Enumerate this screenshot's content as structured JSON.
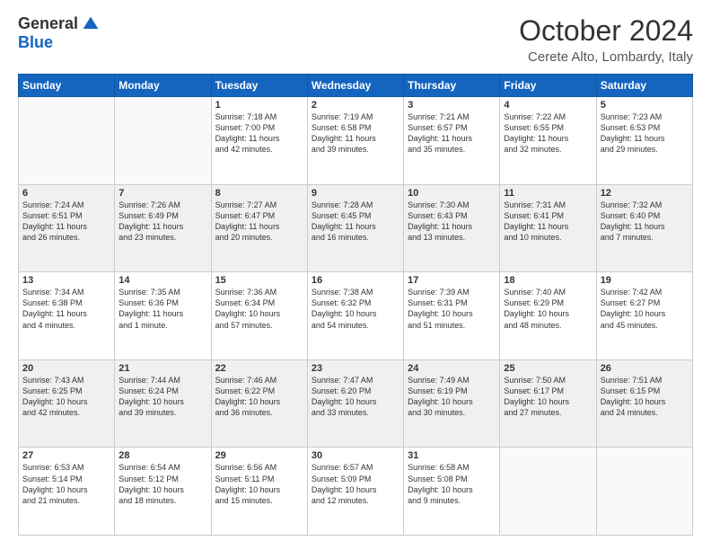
{
  "logo": {
    "general": "General",
    "blue": "Blue"
  },
  "title": "October 2024",
  "location": "Cerete Alto, Lombardy, Italy",
  "days_header": [
    "Sunday",
    "Monday",
    "Tuesday",
    "Wednesday",
    "Thursday",
    "Friday",
    "Saturday"
  ],
  "weeks": [
    [
      {
        "day": "",
        "info": "",
        "empty": true
      },
      {
        "day": "",
        "info": "",
        "empty": true
      },
      {
        "day": "1",
        "info": "Sunrise: 7:18 AM\nSunset: 7:00 PM\nDaylight: 11 hours\nand 42 minutes."
      },
      {
        "day": "2",
        "info": "Sunrise: 7:19 AM\nSunset: 6:58 PM\nDaylight: 11 hours\nand 39 minutes."
      },
      {
        "day": "3",
        "info": "Sunrise: 7:21 AM\nSunset: 6:57 PM\nDaylight: 11 hours\nand 35 minutes."
      },
      {
        "day": "4",
        "info": "Sunrise: 7:22 AM\nSunset: 6:55 PM\nDaylight: 11 hours\nand 32 minutes."
      },
      {
        "day": "5",
        "info": "Sunrise: 7:23 AM\nSunset: 6:53 PM\nDaylight: 11 hours\nand 29 minutes."
      }
    ],
    [
      {
        "day": "6",
        "info": "Sunrise: 7:24 AM\nSunset: 6:51 PM\nDaylight: 11 hours\nand 26 minutes.",
        "shaded": true
      },
      {
        "day": "7",
        "info": "Sunrise: 7:26 AM\nSunset: 6:49 PM\nDaylight: 11 hours\nand 23 minutes.",
        "shaded": true
      },
      {
        "day": "8",
        "info": "Sunrise: 7:27 AM\nSunset: 6:47 PM\nDaylight: 11 hours\nand 20 minutes.",
        "shaded": true
      },
      {
        "day": "9",
        "info": "Sunrise: 7:28 AM\nSunset: 6:45 PM\nDaylight: 11 hours\nand 16 minutes.",
        "shaded": true
      },
      {
        "day": "10",
        "info": "Sunrise: 7:30 AM\nSunset: 6:43 PM\nDaylight: 11 hours\nand 13 minutes.",
        "shaded": true
      },
      {
        "day": "11",
        "info": "Sunrise: 7:31 AM\nSunset: 6:41 PM\nDaylight: 11 hours\nand 10 minutes.",
        "shaded": true
      },
      {
        "day": "12",
        "info": "Sunrise: 7:32 AM\nSunset: 6:40 PM\nDaylight: 11 hours\nand 7 minutes.",
        "shaded": true
      }
    ],
    [
      {
        "day": "13",
        "info": "Sunrise: 7:34 AM\nSunset: 6:38 PM\nDaylight: 11 hours\nand 4 minutes."
      },
      {
        "day": "14",
        "info": "Sunrise: 7:35 AM\nSunset: 6:36 PM\nDaylight: 11 hours\nand 1 minute."
      },
      {
        "day": "15",
        "info": "Sunrise: 7:36 AM\nSunset: 6:34 PM\nDaylight: 10 hours\nand 57 minutes."
      },
      {
        "day": "16",
        "info": "Sunrise: 7:38 AM\nSunset: 6:32 PM\nDaylight: 10 hours\nand 54 minutes."
      },
      {
        "day": "17",
        "info": "Sunrise: 7:39 AM\nSunset: 6:31 PM\nDaylight: 10 hours\nand 51 minutes."
      },
      {
        "day": "18",
        "info": "Sunrise: 7:40 AM\nSunset: 6:29 PM\nDaylight: 10 hours\nand 48 minutes."
      },
      {
        "day": "19",
        "info": "Sunrise: 7:42 AM\nSunset: 6:27 PM\nDaylight: 10 hours\nand 45 minutes."
      }
    ],
    [
      {
        "day": "20",
        "info": "Sunrise: 7:43 AM\nSunset: 6:25 PM\nDaylight: 10 hours\nand 42 minutes.",
        "shaded": true
      },
      {
        "day": "21",
        "info": "Sunrise: 7:44 AM\nSunset: 6:24 PM\nDaylight: 10 hours\nand 39 minutes.",
        "shaded": true
      },
      {
        "day": "22",
        "info": "Sunrise: 7:46 AM\nSunset: 6:22 PM\nDaylight: 10 hours\nand 36 minutes.",
        "shaded": true
      },
      {
        "day": "23",
        "info": "Sunrise: 7:47 AM\nSunset: 6:20 PM\nDaylight: 10 hours\nand 33 minutes.",
        "shaded": true
      },
      {
        "day": "24",
        "info": "Sunrise: 7:49 AM\nSunset: 6:19 PM\nDaylight: 10 hours\nand 30 minutes.",
        "shaded": true
      },
      {
        "day": "25",
        "info": "Sunrise: 7:50 AM\nSunset: 6:17 PM\nDaylight: 10 hours\nand 27 minutes.",
        "shaded": true
      },
      {
        "day": "26",
        "info": "Sunrise: 7:51 AM\nSunset: 6:15 PM\nDaylight: 10 hours\nand 24 minutes.",
        "shaded": true
      }
    ],
    [
      {
        "day": "27",
        "info": "Sunrise: 6:53 AM\nSunset: 5:14 PM\nDaylight: 10 hours\nand 21 minutes."
      },
      {
        "day": "28",
        "info": "Sunrise: 6:54 AM\nSunset: 5:12 PM\nDaylight: 10 hours\nand 18 minutes."
      },
      {
        "day": "29",
        "info": "Sunrise: 6:56 AM\nSunset: 5:11 PM\nDaylight: 10 hours\nand 15 minutes."
      },
      {
        "day": "30",
        "info": "Sunrise: 6:57 AM\nSunset: 5:09 PM\nDaylight: 10 hours\nand 12 minutes."
      },
      {
        "day": "31",
        "info": "Sunrise: 6:58 AM\nSunset: 5:08 PM\nDaylight: 10 hours\nand 9 minutes."
      },
      {
        "day": "",
        "info": "",
        "empty": true
      },
      {
        "day": "",
        "info": "",
        "empty": true
      }
    ]
  ]
}
